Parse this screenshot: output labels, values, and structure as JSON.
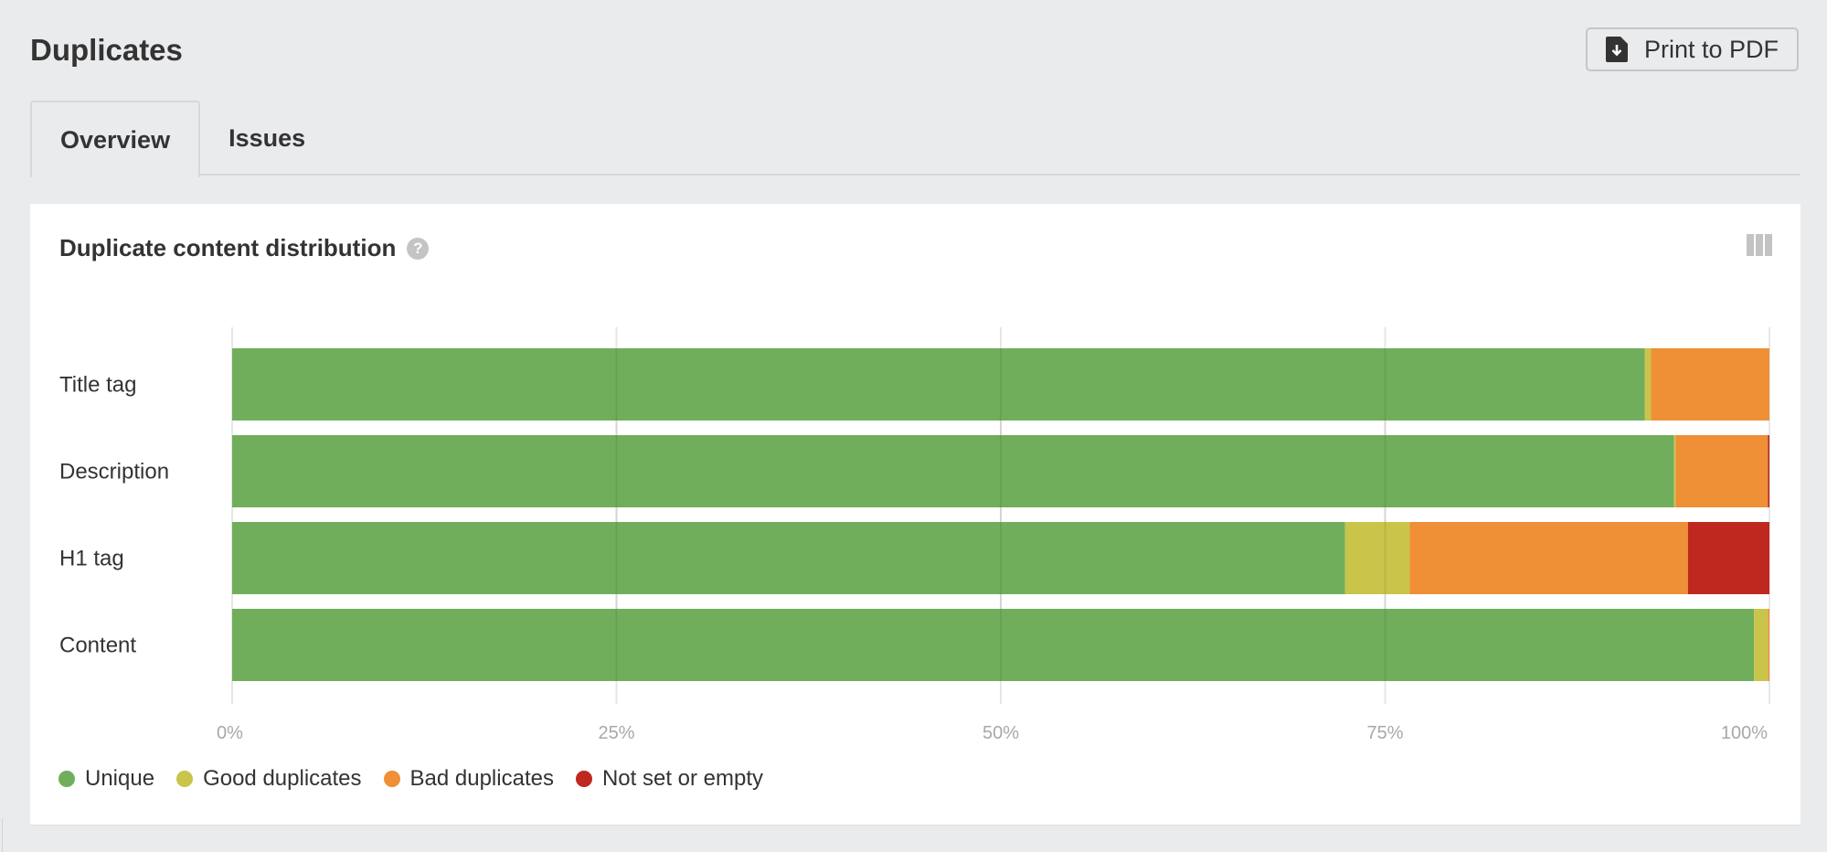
{
  "page": {
    "title": "Duplicates",
    "print_button": {
      "label": "Print to PDF",
      "icon": "file-download-icon"
    }
  },
  "tabs": [
    {
      "label": "Overview",
      "active": true
    },
    {
      "label": "Issues",
      "active": false
    }
  ],
  "card": {
    "title": "Duplicate content distribution",
    "help_icon": "?",
    "columns_icon": "columns-icon"
  },
  "chart_data": {
    "type": "bar",
    "orientation": "horizontal",
    "stacked": true,
    "normalized": true,
    "title": "Duplicate content distribution",
    "xlabel": "",
    "ylabel": "",
    "xlim": [
      0,
      100
    ],
    "x_ticks": [
      "0%",
      "25%",
      "50%",
      "75%",
      "100%"
    ],
    "x_tick_values": [
      0,
      25,
      50,
      75,
      100
    ],
    "grid": true,
    "legend_position": "bottom-left",
    "categories": [
      "Title tag",
      "Description",
      "H1 tag",
      "Content"
    ],
    "series": [
      {
        "name": "Unique",
        "color": "#71ae5b",
        "values": [
          91.9,
          93.8,
          72.4,
          99.0
        ]
      },
      {
        "name": "Good duplicates",
        "color": "#c9c44a",
        "values": [
          0.4,
          0.1,
          4.2,
          0.9
        ]
      },
      {
        "name": "Bad duplicates",
        "color": "#ef8f36",
        "values": [
          7.7,
          6.0,
          18.1,
          0.1
        ]
      },
      {
        "name": "Not set or empty",
        "color": "#be281e",
        "values": [
          0.0,
          0.1,
          5.3,
          0.0
        ]
      }
    ]
  }
}
